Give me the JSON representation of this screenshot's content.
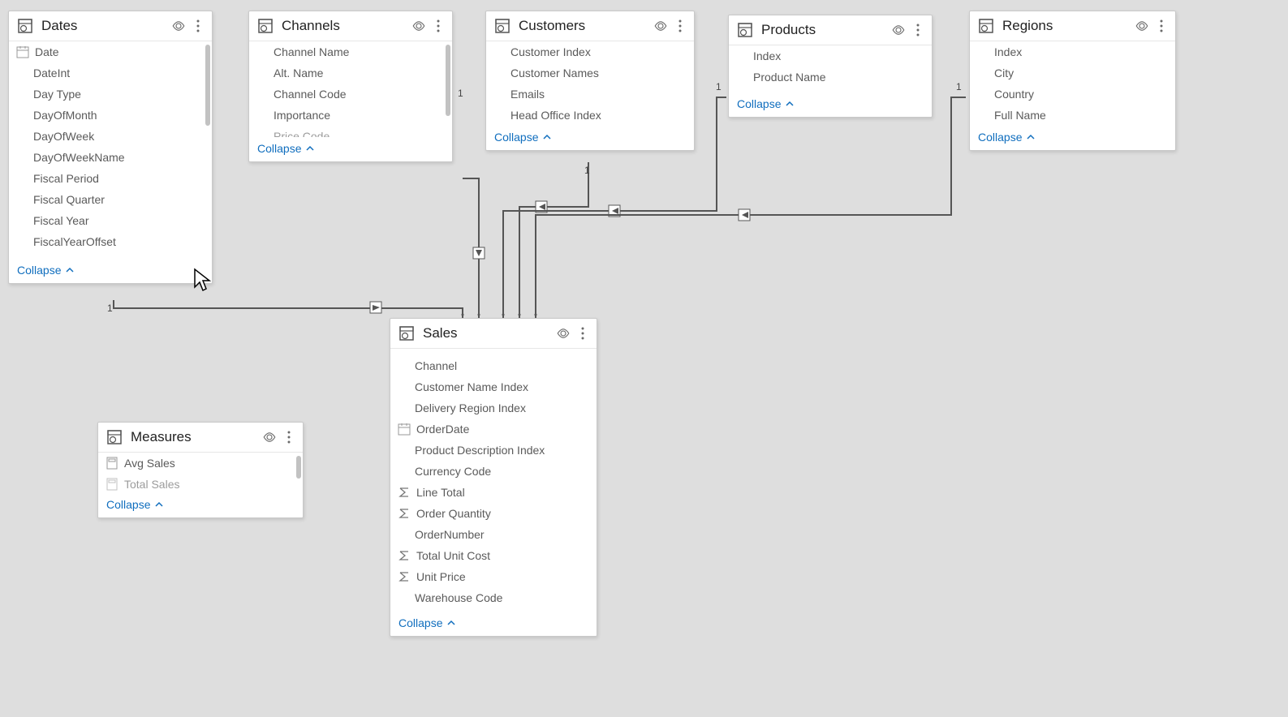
{
  "collapse_label": "Collapse",
  "tables": {
    "dates": {
      "title": "Dates",
      "fields": [
        "Date",
        "DateInt",
        "Day Type",
        "DayOfMonth",
        "DayOfWeek",
        "DayOfWeekName",
        "Fiscal Period",
        "Fiscal Quarter",
        "Fiscal Year",
        "FiscalYearOffset"
      ],
      "field_icons": {
        "0": "calendar"
      }
    },
    "channels": {
      "title": "Channels",
      "fields": [
        "Channel Name",
        "Alt. Name",
        "Channel Code",
        "Importance",
        "Price Code"
      ]
    },
    "customers": {
      "title": "Customers",
      "fields": [
        "Customer Index",
        "Customer Names",
        "Emails",
        "Head Office Index"
      ]
    },
    "products": {
      "title": "Products",
      "fields": [
        "Index",
        "Product Name"
      ]
    },
    "regions": {
      "title": "Regions",
      "fields": [
        "Index",
        "City",
        "Country",
        "Full Name"
      ]
    },
    "measures": {
      "title": "Measures",
      "fields": [
        "Avg Sales",
        "Total Sales"
      ],
      "field_icons": {
        "0": "calculator",
        "1": "calculator"
      }
    },
    "sales": {
      "title": "Sales",
      "fields": [
        "Channel",
        "Customer Name Index",
        "Delivery Region Index",
        "OrderDate",
        "Product Description Index",
        "Currency Code",
        "Line Total",
        "Order Quantity",
        "OrderNumber",
        "Total Unit Cost",
        "Unit Price",
        "Warehouse Code"
      ],
      "field_icons": {
        "3": "calendar",
        "6": "sigma",
        "7": "sigma",
        "9": "sigma",
        "10": "sigma"
      }
    }
  },
  "relationships": [
    {
      "from": "dates",
      "to": "sales"
    },
    {
      "from": "channels",
      "to": "sales"
    },
    {
      "from": "customers",
      "to": "sales"
    },
    {
      "from": "products",
      "to": "sales"
    },
    {
      "from": "regions",
      "to": "sales"
    }
  ],
  "cardinality_label_one": "1",
  "cardinality_label_many": "*"
}
